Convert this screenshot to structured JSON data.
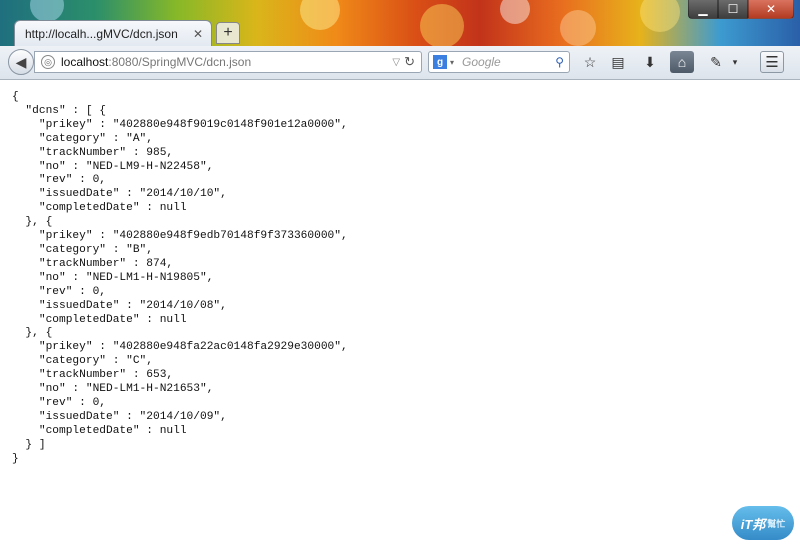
{
  "window": {
    "minimize": "▁",
    "maximize": "☐",
    "close": "✕"
  },
  "tab": {
    "label": "http://localh...gMVC/dcn.json",
    "close": "✕",
    "new_tab": "+"
  },
  "nav": {
    "back_icon": "◀",
    "url_host": "localhost",
    "url_rest": ":8080/SpringMVC/dcn.json",
    "search_engine": "g",
    "search_placeholder": "Google",
    "icons": [
      "star-icon",
      "library-icon",
      "download-icon",
      "home-icon",
      "addon-icon",
      "menu-icon"
    ]
  },
  "json_text": "{\n  \"dcns\" : [ {\n    \"prikey\" : \"402880e948f9019c0148f901e12a0000\",\n    \"category\" : \"A\",\n    \"trackNumber\" : 985,\n    \"no\" : \"NED-LM9-H-N22458\",\n    \"rev\" : 0,\n    \"issuedDate\" : \"2014/10/10\",\n    \"completedDate\" : null\n  }, {\n    \"prikey\" : \"402880e948f9edb70148f9f373360000\",\n    \"category\" : \"B\",\n    \"trackNumber\" : 874,\n    \"no\" : \"NED-LM1-H-N19805\",\n    \"rev\" : 0,\n    \"issuedDate\" : \"2014/10/08\",\n    \"completedDate\" : null\n  }, {\n    \"prikey\" : \"402880e948fa22ac0148fa2929e30000\",\n    \"category\" : \"C\",\n    \"trackNumber\" : 653,\n    \"no\" : \"NED-LM1-H-N21653\",\n    \"rev\" : 0,\n    \"issuedDate\" : \"2014/10/09\",\n    \"completedDate\" : null\n  } ]\n}",
  "watermark": {
    "main": "iT邦",
    "sub": "幫忙"
  }
}
